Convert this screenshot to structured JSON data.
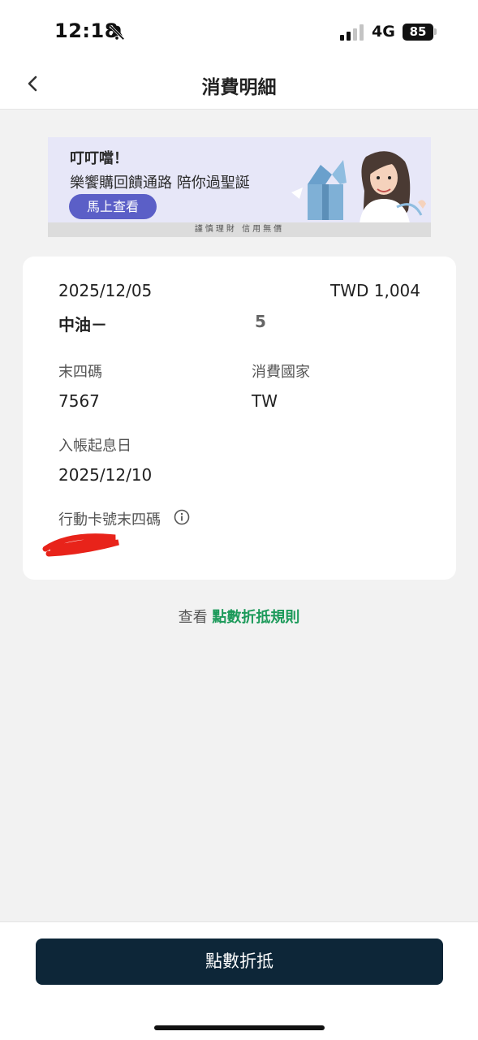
{
  "status_bar": {
    "time": "12:18",
    "network": "4G",
    "battery": "85",
    "icons": [
      "bell-off-icon",
      "signal-icon",
      "battery-icon"
    ]
  },
  "nav": {
    "title": "消費明細",
    "back_icon": "chevron-left-icon"
  },
  "banner": {
    "title": "叮叮噹！",
    "subtitle": "樂饗購回饋通路 陪你過聖誕",
    "cta": "馬上查看",
    "footer": "謹慎理財 信用無價",
    "background": "#e7e7f8",
    "cta_color": "#5b5fc7"
  },
  "transaction": {
    "date": "2025/12/05",
    "amount": "TWD 1,004",
    "merchant": "中油－",
    "merchant_partial": "5",
    "fields": {
      "last4_label": "末四碼",
      "last4_value": "7567",
      "country_label": "消費國家",
      "country_value": "TW",
      "posting_label": "入帳起息日",
      "posting_value": "2025/12/10",
      "mobile_last4_label": "行動卡號末四碼"
    }
  },
  "rules": {
    "prefix": "查看 ",
    "link": "點數折抵規則",
    "link_color": "#1c9a5a"
  },
  "actions": {
    "redeem_label": "點數折抵",
    "button_color": "#0d2638"
  }
}
